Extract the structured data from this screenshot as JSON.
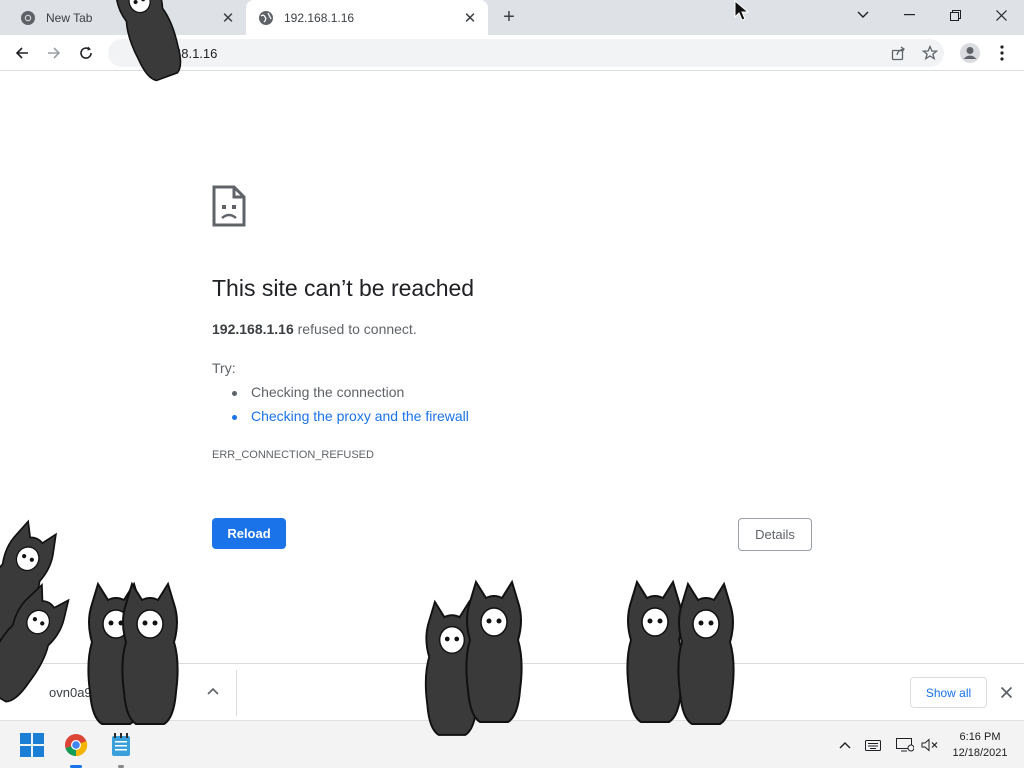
{
  "browser": {
    "tabs": [
      {
        "title": "New Tab",
        "active": false,
        "icon": "chrome-icon"
      },
      {
        "title": "192.168.1.16",
        "active": true,
        "icon": "globe-icon"
      }
    ],
    "url": "192.168.1.16",
    "url_visible": "68.1.16"
  },
  "error_page": {
    "heading": "This site can’t be reached",
    "host": "192.168.1.16",
    "message_suffix": " refused to connect.",
    "try_label": "Try:",
    "suggestions": [
      "Checking the connection",
      "Checking the proxy and the firewall"
    ],
    "error_code": "ERR_CONNECTION_REFUSED",
    "reload_label": "Reload",
    "details_label": "Details"
  },
  "download_bar": {
    "file_name": "ovn0a9",
    "show_all_label": "Show all"
  },
  "taskbar": {
    "time": "6:16 PM",
    "date": "12/18/2021"
  },
  "colors": {
    "accent": "#1a73e8",
    "tabbar": "#dee1e6",
    "critter": "#3a3a3a"
  }
}
